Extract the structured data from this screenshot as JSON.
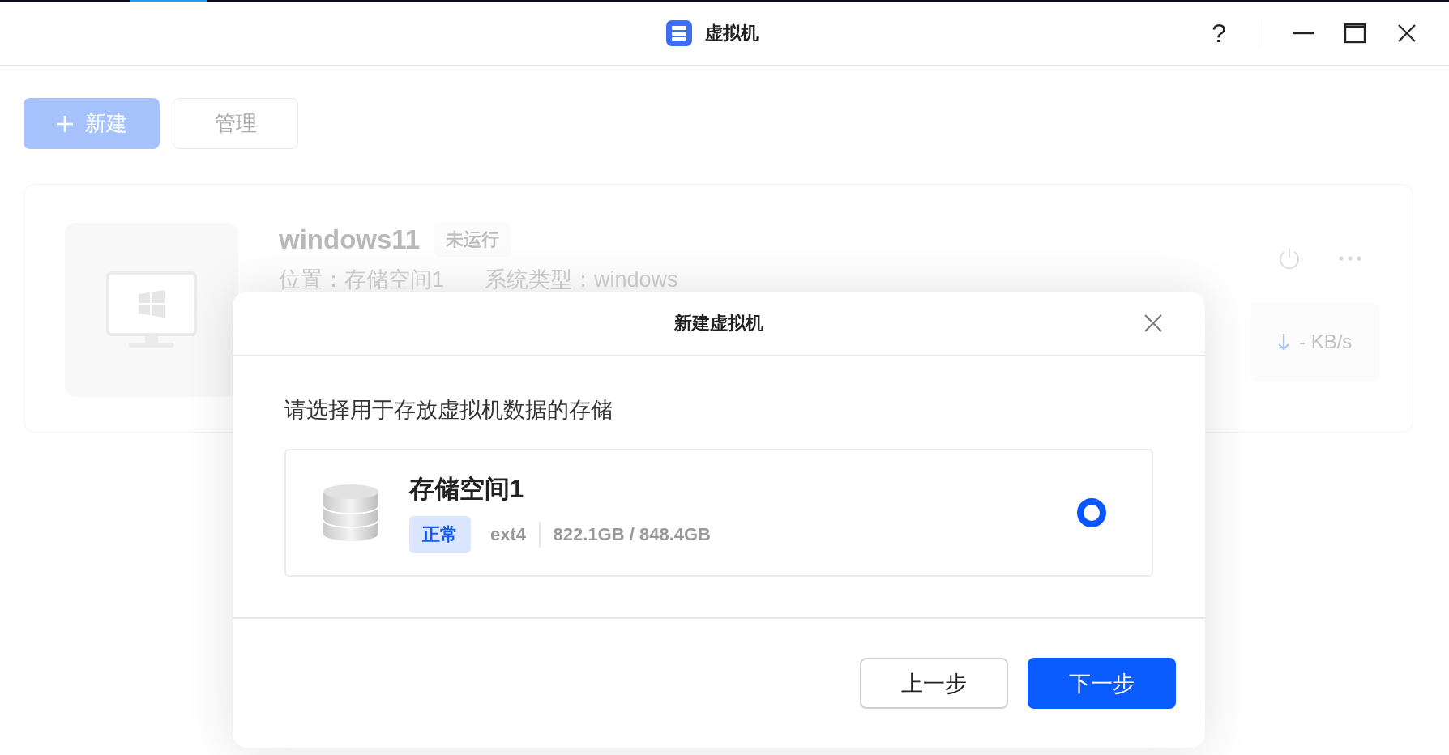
{
  "window": {
    "title": "虚拟机",
    "help": "?"
  },
  "toolbar": {
    "buttons": [
      {
        "label": "新建",
        "kind": "primary"
      },
      {
        "label": "管理",
        "kind": "secondary"
      }
    ]
  },
  "vm_card": {
    "name": "windows11",
    "status": "未运行",
    "location": "位置：存储空间1",
    "os_type": "系统类型：windows",
    "speed": "- KB/s"
  },
  "dialog": {
    "title": "新建虚拟机",
    "prompt": "请选择用于存放虚拟机数据的存储",
    "storage_options": [
      {
        "name": "存储空间1",
        "status": "正常",
        "filesystem": "ext4",
        "capacity": "822.1GB / 848.4GB",
        "selected": true
      }
    ],
    "buttons": [
      {
        "label": "上一步",
        "kind": "secondary"
      },
      {
        "label": "下一步",
        "kind": "primary"
      }
    ]
  }
}
